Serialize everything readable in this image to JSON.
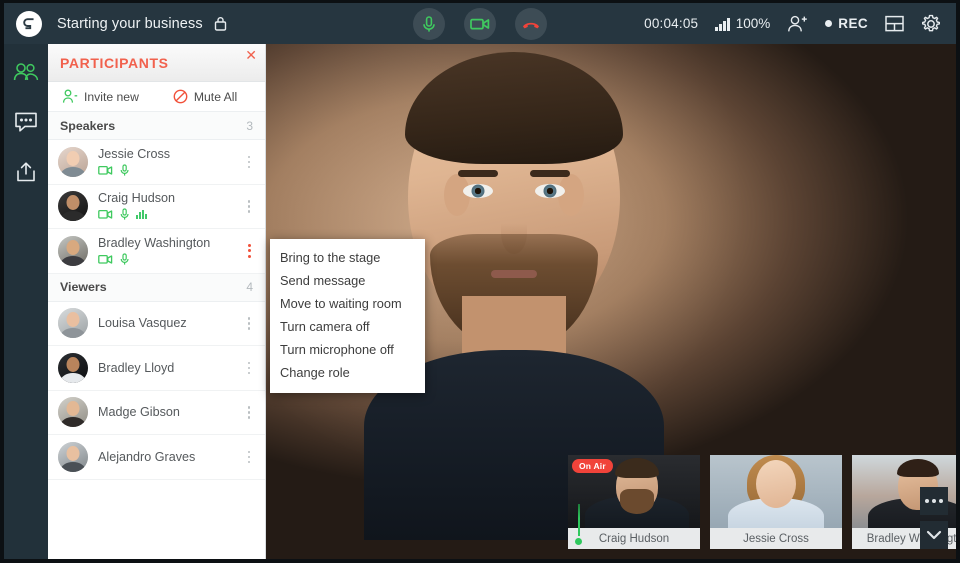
{
  "header": {
    "title": "Starting your business",
    "lock_icon": "lock-icon",
    "logo_icon": "app-logo-icon",
    "timer": "00:04:05",
    "signal_icon": "signal-bars-icon",
    "signal_percent": "100%",
    "add_participant_icon": "add-person-icon",
    "rec_label": "REC",
    "layout_icon": "layout-grid-icon",
    "settings_icon": "gear-icon",
    "controls": [
      {
        "name": "microphone-toggle-button",
        "icon": "microphone-icon",
        "color": "#3fc95f"
      },
      {
        "name": "camera-toggle-button",
        "icon": "camera-icon",
        "color": "#3fc95f"
      },
      {
        "name": "end-call-button",
        "icon": "phone-hangup-icon",
        "color": "#f1433a"
      }
    ]
  },
  "rail": {
    "items": [
      {
        "name": "sidebar-item-participants",
        "icon": "people-icon",
        "active": true
      },
      {
        "name": "sidebar-item-chat",
        "icon": "chat-bubble-icon",
        "active": false
      },
      {
        "name": "sidebar-item-share",
        "icon": "share-upload-icon",
        "active": false
      }
    ]
  },
  "panel": {
    "title": "PARTICIPANTS",
    "close_icon": "close-icon",
    "invite_label": "Invite new",
    "invite_icon": "add-person-icon",
    "mute_all_label": "Mute All",
    "mute_all_icon": "mute-circle-icon",
    "sections": [
      {
        "name": "Speakers",
        "count": "3",
        "people": [
          {
            "name": "Jessie Cross",
            "camera": true,
            "mic": true,
            "level": false,
            "menu_active": false
          },
          {
            "name": "Craig Hudson",
            "camera": true,
            "mic": true,
            "level": true,
            "menu_active": false
          },
          {
            "name": "Bradley Washington",
            "camera": true,
            "mic": true,
            "level": false,
            "menu_active": true
          }
        ]
      },
      {
        "name": "Viewers",
        "count": "4",
        "people": [
          {
            "name": "Louisa Vasquez",
            "camera": false,
            "mic": false,
            "level": false,
            "menu_active": false
          },
          {
            "name": "Bradley Lloyd",
            "camera": false,
            "mic": false,
            "level": false,
            "menu_active": false
          },
          {
            "name": "Madge Gibson",
            "camera": false,
            "mic": false,
            "level": false,
            "menu_active": false
          },
          {
            "name": "Alejandro Graves",
            "camera": false,
            "mic": false,
            "level": false,
            "menu_active": false
          }
        ]
      }
    ]
  },
  "context_menu": {
    "items": [
      "Bring to the stage",
      "Send message",
      "Move to waiting room",
      "Turn camera off",
      "Turn microphone off",
      "Change role"
    ]
  },
  "thumbnails": [
    {
      "name": "Craig Hudson",
      "on_air": true,
      "on_air_label": "On Air",
      "audio_meter": true
    },
    {
      "name": "Jessie Cross",
      "on_air": false,
      "on_air_label": "",
      "audio_meter": false
    },
    {
      "name": "Bradley Washington",
      "on_air": false,
      "on_air_label": "",
      "audio_meter": false
    }
  ],
  "corner_buttons": [
    {
      "name": "more-options-button",
      "icon": "three-dots-icon"
    },
    {
      "name": "collapse-strip-button",
      "icon": "chevron-down-icon"
    }
  ],
  "colors": {
    "accent": "#f1614d",
    "header_bg": "#263640",
    "rail_bg": "#22313a",
    "green": "#3fc95f",
    "red": "#f1433a"
  }
}
